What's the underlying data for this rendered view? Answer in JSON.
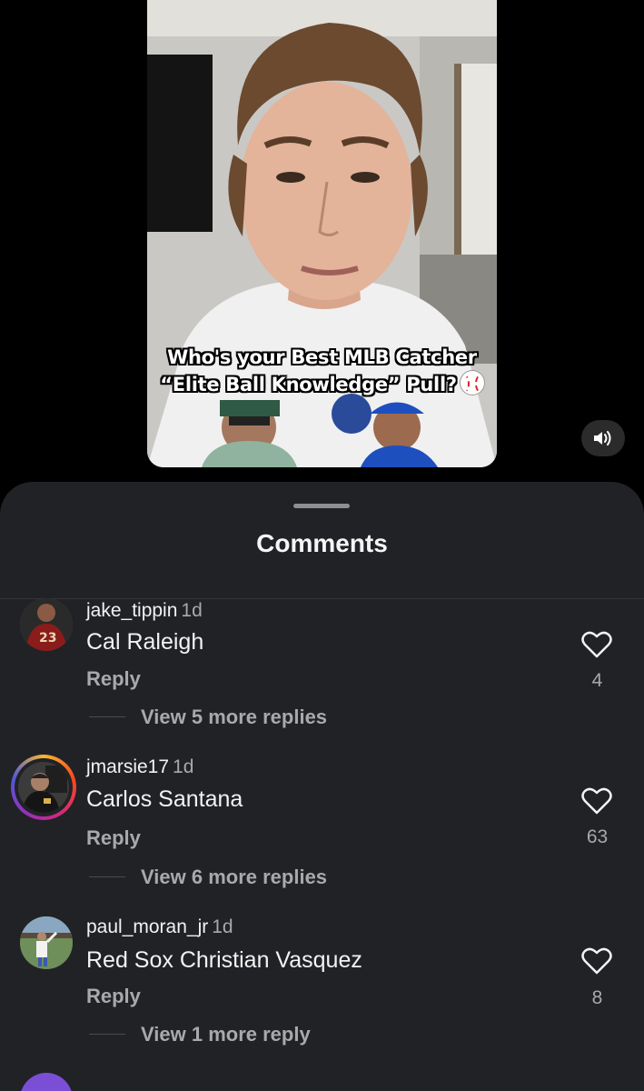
{
  "video": {
    "caption_line1": "Who's your Best MLB Catcher",
    "caption_line2": "“Elite Ball Knowledge” Pull?",
    "caption_emoji": "baseball-icon",
    "sound_icon": "speaker-icon"
  },
  "sheet": {
    "title": "Comments"
  },
  "comments": [
    {
      "username": "jake_tippin",
      "time": "1d",
      "text": "Cal Raleigh",
      "reply_label": "Reply",
      "likes": "4",
      "more_replies": "View 5 more replies"
    },
    {
      "username": "jmarsie17",
      "time": "1d",
      "text": "Carlos Santana",
      "reply_label": "Reply",
      "likes": "63",
      "more_replies": "View 6 more replies"
    },
    {
      "username": "paul_moran_jr",
      "time": "1d",
      "text": "Red Sox Christian Vasquez",
      "reply_label": "Reply",
      "likes": "8",
      "more_replies": "View 1 more reply"
    }
  ],
  "colors": {
    "sheet_bg": "#212226",
    "primary_text": "#f2f2f2",
    "secondary_text": "#a8a9ad"
  }
}
